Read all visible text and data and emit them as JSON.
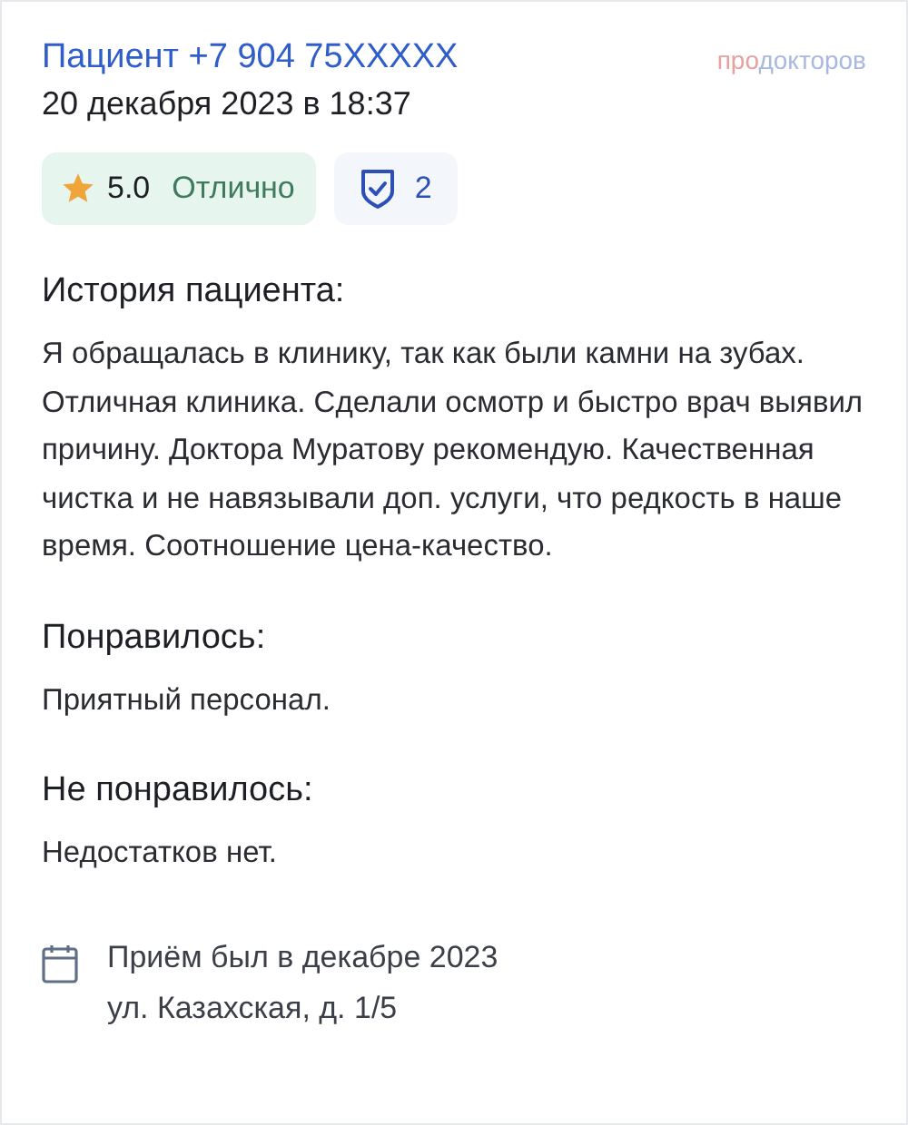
{
  "patient": {
    "name": "Пациент +7 904 75XXXXX",
    "date": "20 декабря 2023 в 18:37"
  },
  "logo": [
    {
      "text": "про",
      "color": "#e8a0a0"
    },
    {
      "text": "докторов",
      "color": "#a9b8de"
    }
  ],
  "rating": {
    "score": "5.0",
    "verdict": "Отлично"
  },
  "verified": {
    "count": "2"
  },
  "sections": [
    {
      "title": "История пациента:",
      "text": "Я обращалась в клинику, так как были камни на зубах. Отличная клиника. Сделали осмотр и быстро врач выявил причину. Доктора Муратову рекомендую. Качественная чистка и не навязывали доп. услуги, что редкость в наше время. Соотношение цена-качество."
    },
    {
      "title": "Понравилось:",
      "text": "Приятный персонал."
    },
    {
      "title": "Не понравилось:",
      "text": "Недостатков нет."
    }
  ],
  "visit": {
    "when": "Приём был в декабре 2023",
    "address": "ул. Казахская, д. 1/5"
  }
}
